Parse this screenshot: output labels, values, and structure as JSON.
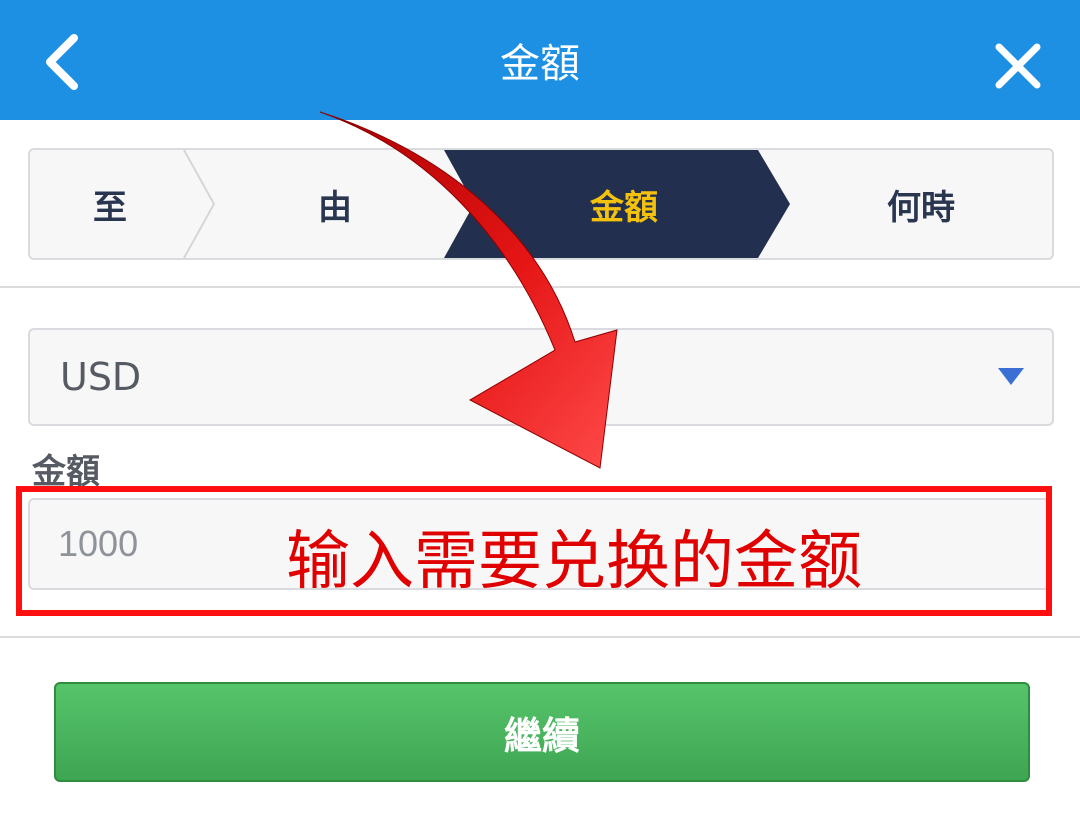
{
  "header": {
    "title": "金額",
    "back_icon": "chevron-left-icon",
    "close_icon": "close-icon",
    "bg_color": "#1e90e4"
  },
  "steps": [
    {
      "label": "至",
      "active": false
    },
    {
      "label": "由",
      "active": false
    },
    {
      "label": "金額",
      "active": true
    },
    {
      "label": "何時",
      "active": false
    }
  ],
  "currency_select": {
    "selected": "USD",
    "icon": "caret-down-icon"
  },
  "amount_field": {
    "label": "金額",
    "placeholder": "1000"
  },
  "annotation": {
    "text": "输入需要兑换的金额",
    "color": "#e00000",
    "arrow_icon": "curved-arrow-icon"
  },
  "continue_button": {
    "label": "繼續",
    "color": "#4bb55f"
  },
  "colors": {
    "active_step_bg": "#232f4e",
    "active_step_text": "#f4c20d"
  }
}
